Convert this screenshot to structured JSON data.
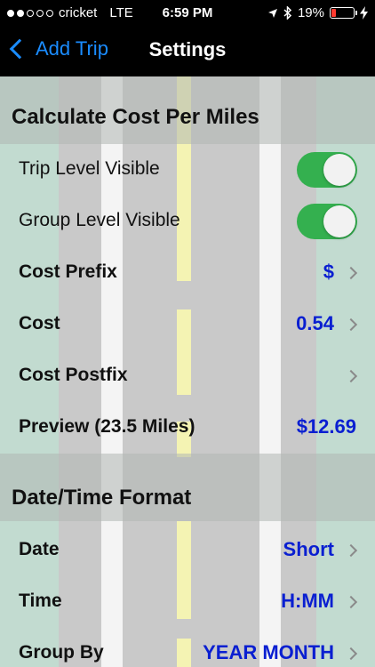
{
  "status_bar": {
    "carrier": "cricket",
    "network": "LTE",
    "time": "6:59 PM",
    "battery": "19%",
    "battery_level": 0.19,
    "signal_bars_filled": 2,
    "signal_bars_total": 5
  },
  "nav": {
    "back_label": "Add Trip",
    "title": "Settings"
  },
  "sections": [
    {
      "header": "Calculate Cost Per Miles",
      "rows": [
        {
          "label": "Trip Level Visible",
          "toggle": true
        },
        {
          "label": "Group Level Visible",
          "toggle": true
        },
        {
          "label": "Cost Prefix",
          "value": "$"
        },
        {
          "label": "Cost",
          "value": "0.54"
        },
        {
          "label": "Cost Postfix",
          "value": ""
        },
        {
          "label": "Preview (23.5 Miles)",
          "value": "$12.69"
        }
      ]
    },
    {
      "header": "Date/Time Format",
      "rows": [
        {
          "label": "Date",
          "value": "Short"
        },
        {
          "label": "Time",
          "value": "H:MM"
        },
        {
          "label": "Group By",
          "value": "YEAR MONTH"
        }
      ]
    }
  ],
  "colors": {
    "accent_value": "#0a1fd1",
    "back_link": "#1a8cff",
    "toggle_on": "#34b04f",
    "battery_low": "#ff3b30"
  }
}
